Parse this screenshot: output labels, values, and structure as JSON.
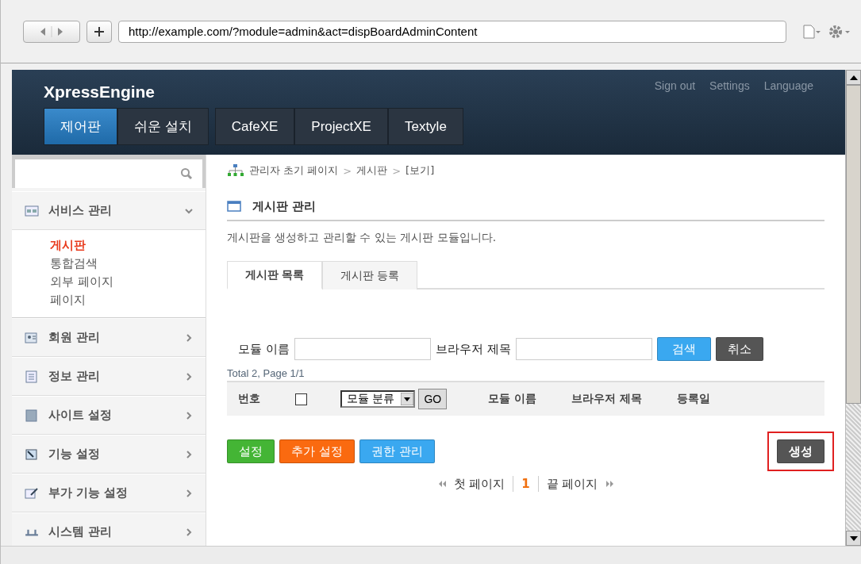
{
  "browser": {
    "url": "http://example.com/?module=admin&act=dispBoardAdminContent"
  },
  "header": {
    "logo": "XpressEngine",
    "links": [
      "Sign out",
      "Settings",
      "Language"
    ],
    "nav": [
      {
        "label": "제어판",
        "selected": true
      },
      {
        "label": "쉬운 설치",
        "selected": false
      },
      {
        "label": "CafeXE",
        "selected": false
      },
      {
        "label": "ProjectXE",
        "selected": false
      },
      {
        "label": "Textyle",
        "selected": false
      }
    ]
  },
  "sidebar": {
    "items": [
      {
        "label": "서비스 관리",
        "expanded": true,
        "children": [
          {
            "label": "게시판",
            "selected": true
          },
          {
            "label": "통합검색",
            "selected": false
          },
          {
            "label": "외부 페이지",
            "selected": false
          },
          {
            "label": "페이지",
            "selected": false
          }
        ]
      },
      {
        "label": "회원 관리",
        "expanded": false
      },
      {
        "label": "정보 관리",
        "expanded": false
      },
      {
        "label": "사이트 설정",
        "expanded": false
      },
      {
        "label": "기능 설정",
        "expanded": false
      },
      {
        "label": "부가 기능 설정",
        "expanded": false
      },
      {
        "label": "시스템 관리",
        "expanded": false
      }
    ]
  },
  "breadcrumb": {
    "items": [
      "관리자 초기 페이지",
      "게시판",
      "[보기]"
    ],
    "separators": [
      ">",
      ">"
    ]
  },
  "page": {
    "title": "게시판 관리",
    "description": "게시판을 생성하고 관리할 수 있는 게시판 모듈입니다."
  },
  "tabs": [
    {
      "label": "게시판 목록",
      "selected": true
    },
    {
      "label": "게시판 등록",
      "selected": false
    }
  ],
  "search": {
    "fields": [
      {
        "label": "모듈 이름"
      },
      {
        "label": "브라우저 제목"
      }
    ],
    "buttons": [
      {
        "label": "검색",
        "kind": "blue"
      },
      {
        "label": "취소",
        "kind": "dark"
      }
    ]
  },
  "summary": "Total 2, Page 1/1",
  "table": {
    "columns": [
      {
        "label": "번호",
        "kind": "text"
      },
      {
        "kind": "checkbox",
        "checked": false
      },
      {
        "label": "모듈 분류",
        "kind": "select",
        "go": "GO"
      },
      {
        "label": "모듈 이름",
        "kind": "text"
      },
      {
        "label": "브라우저 제목",
        "kind": "text"
      },
      {
        "label": "등록일",
        "kind": "text"
      }
    ]
  },
  "actions": [
    {
      "label": "설정",
      "kind": "green"
    },
    {
      "label": "추가 설정",
      "kind": "orange"
    },
    {
      "label": "권한 관리",
      "kind": "blue"
    }
  ],
  "create_button": {
    "label": "생성",
    "highlighted": true
  },
  "pagination": {
    "first": "첫 페이지",
    "pages": [
      {
        "label": "1",
        "selected": true
      }
    ],
    "last": "끝 페이지"
  }
}
